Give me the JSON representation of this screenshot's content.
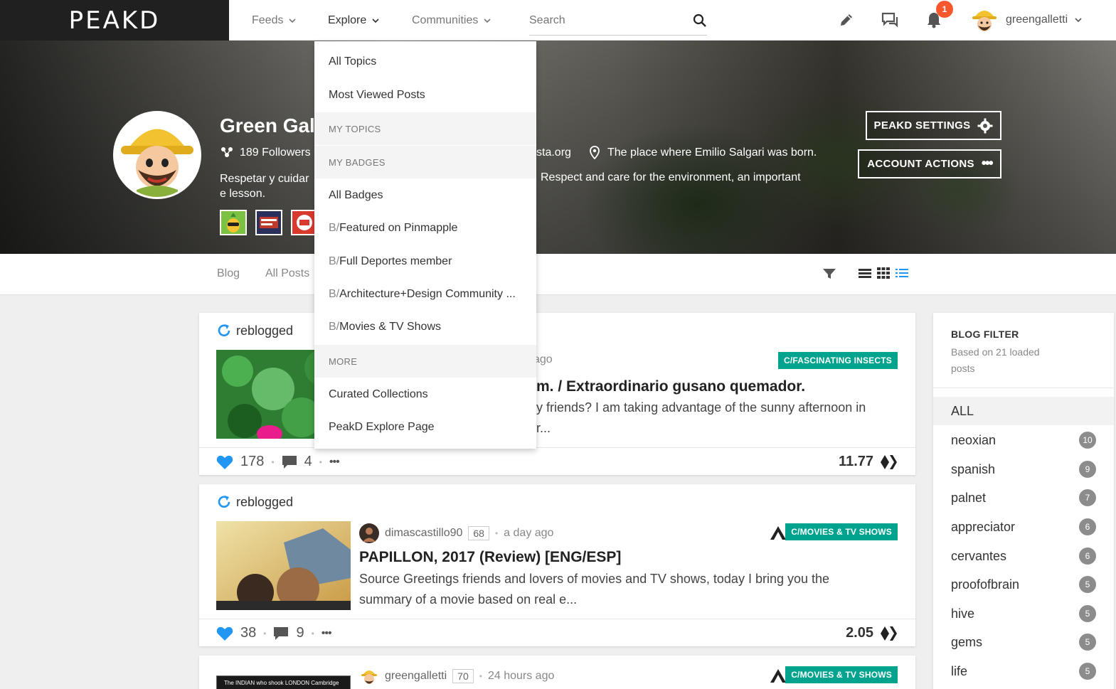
{
  "topbar": {
    "logo": "PEAKD",
    "feeds": "Feeds",
    "explore": "Explore",
    "communities": "Communities",
    "search_placeholder": "Search",
    "notification_count": "1",
    "username": "greengalletti"
  },
  "profile": {
    "name": "Green Galletti",
    "followers": "189 Followers",
    "website": "sta.org",
    "location": "The place where Emilio Salgari was born.",
    "bio_left": "Respetar y cuidar e lesson.",
    "bio_right": "Respect and care for the environment, an important",
    "settings_button": "PEAKD SETTINGS",
    "account_button": "ACCOUNT ACTIONS"
  },
  "subnav": {
    "blog": "Blog",
    "all_posts": "All Posts"
  },
  "dropdown": {
    "all_topics": "All Topics",
    "most_viewed": "Most Viewed Posts",
    "my_topics": "MY TOPICS",
    "my_badges": "MY BADGES",
    "all_badges": "All Badges",
    "badge_prefix": "B/",
    "badges": [
      "Featured on Pinmapple",
      "Full Deportes member",
      "Architecture+Design Community ...",
      "Movies & TV Shows"
    ],
    "more": "MORE",
    "curated": "Curated Collections",
    "explore_page": "PeakD Explore Page"
  },
  "posts": [
    {
      "reblogged": "reblogged",
      "time": "ago",
      "community": "C/FASCINATING INSECTS",
      "title": "m. / Extraordinario gusano quemador.",
      "snippet_line1": "y friends? I am taking advantage of the sunny afternoon in",
      "snippet_line2": "r...",
      "likes": "178",
      "comments": "4",
      "payout": "11.77"
    },
    {
      "reblogged": "reblogged",
      "author": "dimascastillo90",
      "rep": "68",
      "time": "a day ago",
      "community": "C/MOVIES & TV SHOWS",
      "title": "PAPILLON, 2017 (Review) [ENG/ESP]",
      "snippet": "Source Greetings friends and lovers of movies and TV shows, today I bring you the summary of a movie based on real e...",
      "likes": "38",
      "comments": "9",
      "payout": "2.05"
    },
    {
      "author": "greengalletti",
      "rep": "70",
      "time": "24 hours ago",
      "community": "C/MOVIES & TV SHOWS",
      "thumb_text": "The INDIAN who shook LONDON Cambridge"
    }
  ],
  "sidebar": {
    "title": "BLOG FILTER",
    "subtitle": "Based on 21 loaded posts",
    "all": "ALL",
    "items": [
      {
        "name": "neoxian",
        "count": "10"
      },
      {
        "name": "spanish",
        "count": "9"
      },
      {
        "name": "palnet",
        "count": "7"
      },
      {
        "name": "appreciator",
        "count": "6"
      },
      {
        "name": "cervantes",
        "count": "6"
      },
      {
        "name": "proofofbrain",
        "count": "5"
      },
      {
        "name": "hive",
        "count": "5"
      },
      {
        "name": "gems",
        "count": "5"
      },
      {
        "name": "life",
        "count": "5"
      }
    ]
  }
}
